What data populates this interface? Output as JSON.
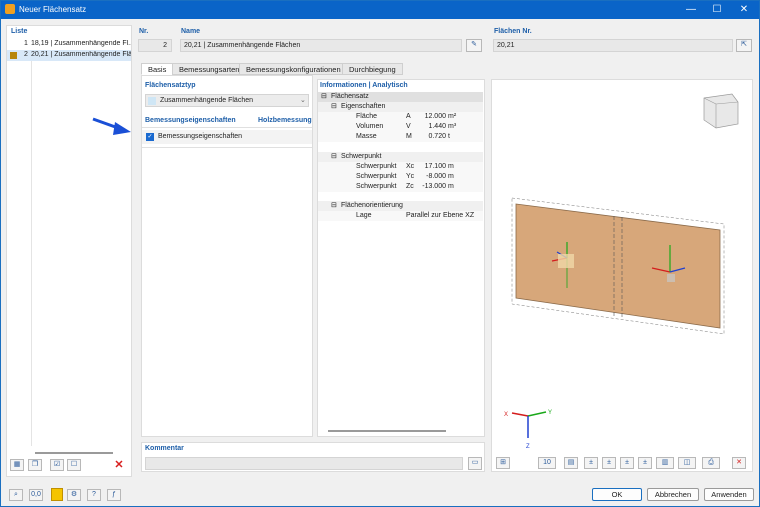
{
  "window": {
    "title": "Neuer Flächensatz",
    "min": "—",
    "max": "☐",
    "close": "✕"
  },
  "list": {
    "header": "Liste",
    "items": [
      {
        "num": "1",
        "label": "18,19 | Zusammenhängende Fl..."
      },
      {
        "num": "2",
        "label": "20,21 | Zusammenhängende Fläc..."
      }
    ],
    "selected_color": "#b8860b"
  },
  "nr": {
    "header": "Nr.",
    "value": "2"
  },
  "name": {
    "header": "Name",
    "value": "20,21 | Zusammenhängende Flächen"
  },
  "flaechen": {
    "header": "Flächen Nr.",
    "value": "20,21"
  },
  "tabs": [
    "Basis",
    "Bemessungsarten",
    "Bemessungskonfigurationen",
    "Durchbiegung"
  ],
  "basis": {
    "typ_header": "Flächensatztyp",
    "typ_value": "Zusammenhängende Flächen",
    "bem_header": "Bemessungseigenschaften",
    "holz_header": "Holzbemessung",
    "bem_checkbox": "Bemessungseigenschaften"
  },
  "info": {
    "header": "Informationen | Analytisch",
    "root": "Flächensatz",
    "eig": "Eigenschaften",
    "eig_rows": [
      {
        "name": "Fläche",
        "sym": "A",
        "val": "12.000",
        "unit": "m²"
      },
      {
        "name": "Volumen",
        "sym": "V",
        "val": "1.440",
        "unit": "m³"
      },
      {
        "name": "Masse",
        "sym": "M",
        "val": "0.720",
        "unit": "t"
      }
    ],
    "sp": "Schwerpunkt",
    "sp_rows": [
      {
        "name": "Schwerpunkt",
        "sym": "Xc",
        "val": "17.100",
        "unit": "m"
      },
      {
        "name": "Schwerpunkt",
        "sym": "Yc",
        "val": "-8.000",
        "unit": "m"
      },
      {
        "name": "Schwerpunkt",
        "sym": "Zc",
        "val": "-13.000",
        "unit": "m"
      }
    ],
    "orient": "Flächenorientierung",
    "lage_name": "Lage",
    "lage_val": "Parallel zur Ebene XZ"
  },
  "kommentar": {
    "header": "Kommentar",
    "value": ""
  },
  "buttons": {
    "ok": "OK",
    "cancel": "Abbrechen",
    "apply": "Anwenden"
  },
  "viewer": {
    "zoom": "10"
  }
}
